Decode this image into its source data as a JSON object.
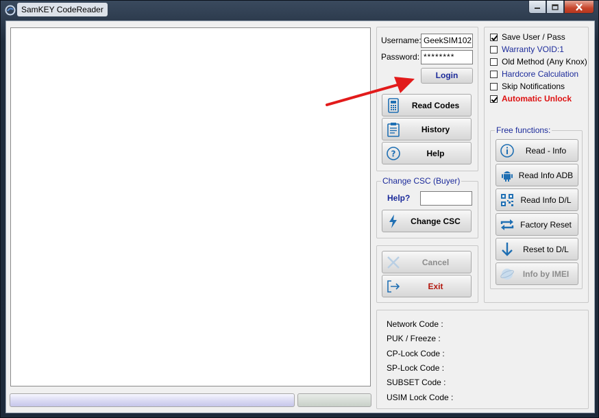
{
  "window": {
    "title": "SamKEY CodeReader",
    "controls": {
      "minimize": "minimize-icon",
      "maximize": "maximize-icon",
      "close": "close-icon"
    }
  },
  "login": {
    "username_label": "Username:",
    "username_value": "GeekSIM102",
    "password_label": "Password:",
    "password_value": "********",
    "login_button": "Login",
    "read_codes": "Read Codes",
    "history": "History",
    "help": "Help"
  },
  "csc": {
    "caption": "Change CSC (Buyer)",
    "help_label": "Help?",
    "input_value": "",
    "change_button": "Change CSC"
  },
  "actions": {
    "cancel": "Cancel",
    "exit": "Exit"
  },
  "options": [
    {
      "label": "Save User / Pass",
      "checked": true,
      "style": "normal"
    },
    {
      "label": "Warranty VOID:1",
      "checked": false,
      "style": "blue"
    },
    {
      "label": "Old Method (Any Knox)",
      "checked": false,
      "style": "normal"
    },
    {
      "label": "Hardcore Calculation",
      "checked": false,
      "style": "blue"
    },
    {
      "label": "Skip Notifications",
      "checked": false,
      "style": "normal"
    },
    {
      "label": "Automatic Unlock",
      "checked": true,
      "style": "red"
    }
  ],
  "free_functions": {
    "caption": "Free functions:",
    "buttons": [
      "Read - Info",
      "Read Info ADB",
      "Read Info D/L",
      "Factory Reset",
      "Reset to D/L",
      "Info by IMEI"
    ]
  },
  "codes": [
    "Network Code :",
    "PUK / Freeze :",
    "CP-Lock Code :",
    "SP-Lock Code :",
    "SUBSET Code :",
    "USIM Lock Code :"
  ],
  "colors": {
    "accent_blue": "#1b2a9a",
    "unlock_red": "#dd1111",
    "exit_red": "#b3160d",
    "arrow_red": "#e21b1b"
  }
}
